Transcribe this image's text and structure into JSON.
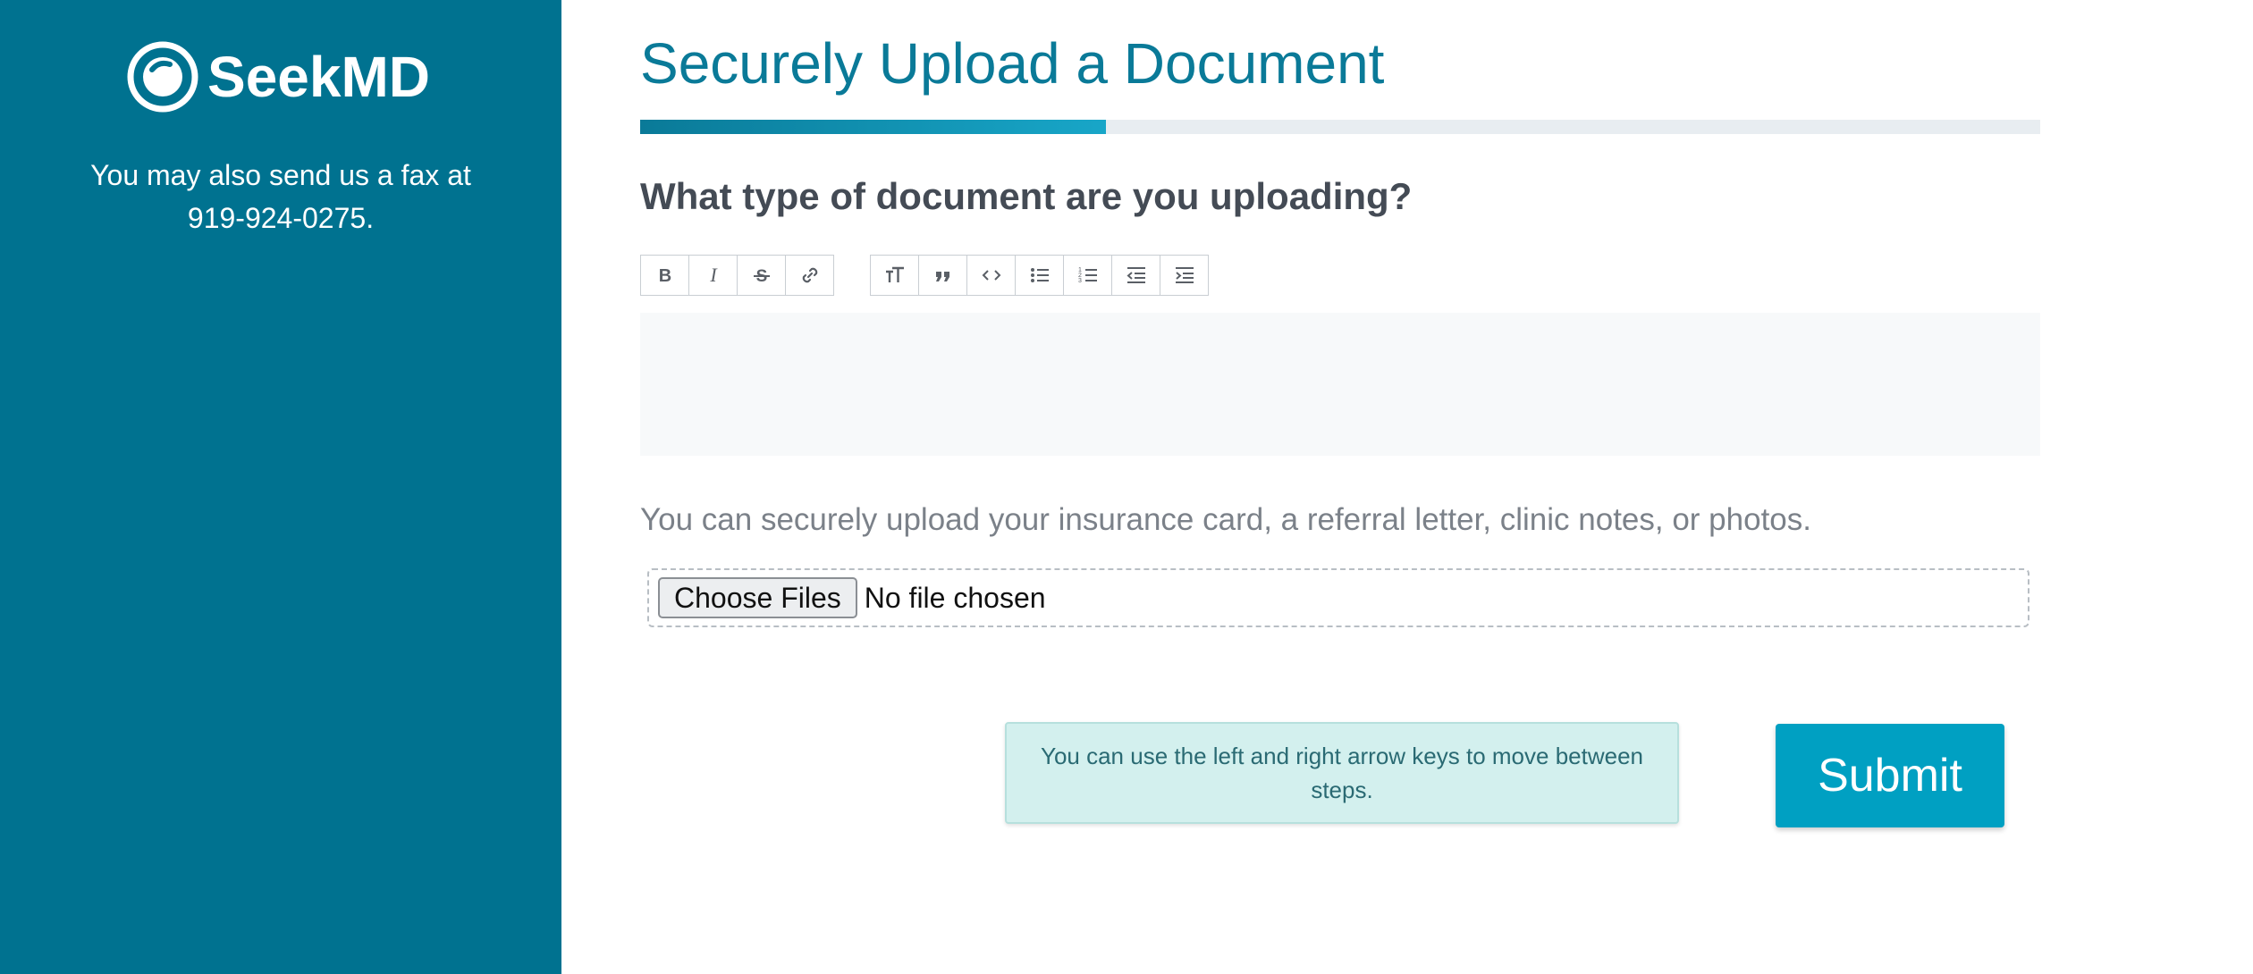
{
  "sidebar": {
    "logo_text": "SeekMD",
    "fax_note_line1": "You may also send us a fax at",
    "fax_note_line2": "919-924-0275."
  },
  "main": {
    "title": "Securely Upload a Document",
    "progress_fraction": 0.333,
    "question": "What type of document are you uploading?",
    "toolbar": {
      "formatting": [
        {
          "name": "bold",
          "glyph": "B"
        },
        {
          "name": "italic",
          "glyph": "I"
        },
        {
          "name": "strikethrough",
          "glyph": "S"
        },
        {
          "name": "link",
          "glyph": "link"
        }
      ],
      "blocks": [
        {
          "name": "heading",
          "glyph": "TT"
        },
        {
          "name": "quote",
          "glyph": "quote"
        },
        {
          "name": "code",
          "glyph": "<>"
        },
        {
          "name": "bullet-list",
          "glyph": "bullets"
        },
        {
          "name": "numbered-list",
          "glyph": "numbers"
        },
        {
          "name": "decrease-indent",
          "glyph": "outdent"
        },
        {
          "name": "increase-indent",
          "glyph": "indent"
        }
      ]
    },
    "editor_value": "",
    "upload_hint": "You can securely upload your insurance card, a referral letter, clinic notes, or photos.",
    "file_button_label": "Choose Files",
    "file_status": "No file chosen",
    "arrow_note": "You can use the left and right arrow keys to move between steps.",
    "submit_label": "Submit"
  },
  "colors": {
    "sidebar_bg": "#007290",
    "title": "#0a7a98",
    "submit_bg": "#00a0c2",
    "note_bg": "#d3f0ee"
  }
}
